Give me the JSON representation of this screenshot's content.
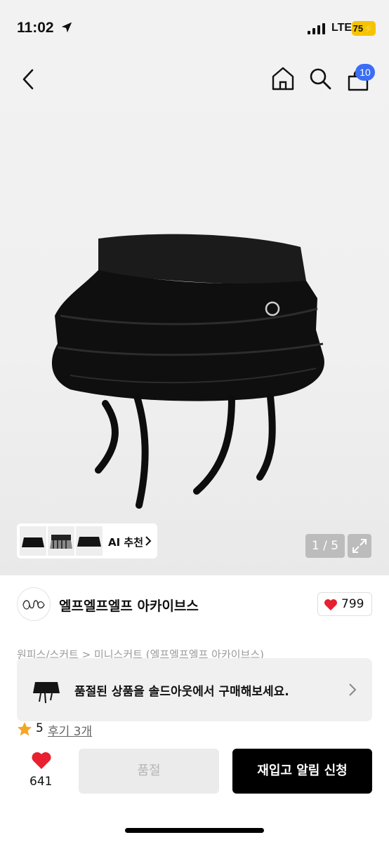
{
  "status_bar": {
    "time": "11:02",
    "carrier": "LTE",
    "battery": "75"
  },
  "nav": {
    "cart_count": "10"
  },
  "gallery": {
    "ai_label": "AI 추천",
    "page_indicator": "1 / 5"
  },
  "shop": {
    "name": "엘프엘프엘프 아카이브스",
    "like_count": "799"
  },
  "product": {
    "category_path": "원피스/스커트 > 미니스커트 (엘프엘프엘프 아카이브스)"
  },
  "soldout_banner": {
    "text": "품절된 상품을 솔드아웃에서 구매해보세요."
  },
  "rating": {
    "score": "5",
    "reviews": "후기 3개"
  },
  "bottom_bar": {
    "wish_count": "641",
    "soldout_label": "품절",
    "restock_label": "재입고 알림 신청"
  },
  "colors": {
    "accent_blue": "#3b6ef5",
    "heart_red": "#e8202f",
    "star_orange": "#f5a623",
    "battery_yellow": "#f5c400"
  }
}
